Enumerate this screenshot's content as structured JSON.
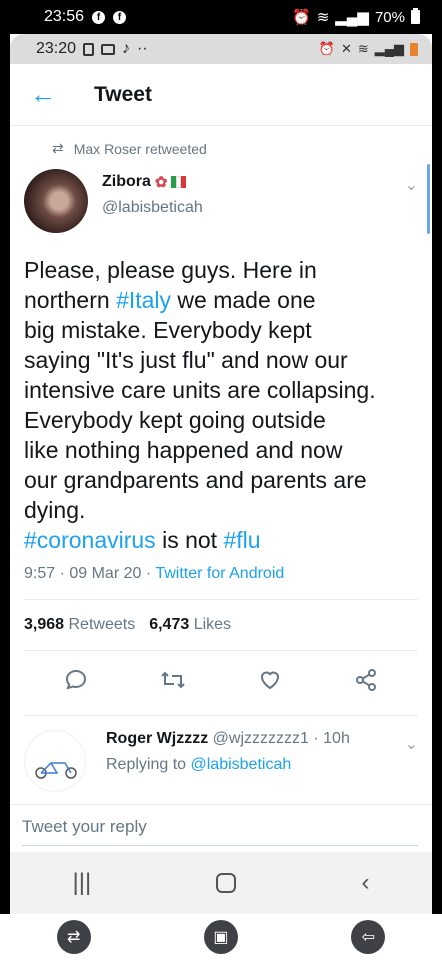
{
  "outer_status": {
    "time": "23:56",
    "battery": "70%"
  },
  "inner_status": {
    "time": "23:20"
  },
  "header": {
    "title": "Tweet"
  },
  "retweet": {
    "text": "Max Roser retweeted"
  },
  "author": {
    "name": "Zibora",
    "handle": "@labisbeticah"
  },
  "tweet": {
    "lines": [
      "Please, please guys. Here in",
      "northern ",
      "#Italy",
      " we made one",
      "big mistake. Everybody kept",
      "saying \"It's just flu\" and now our",
      "intensive care units are collapsing.",
      "Everybody kept going outside",
      "like nothing happened and now",
      "our grandparents and parents are",
      "dying."
    ],
    "tag_coronavirus": "#coronavirus",
    "mid": " is not ",
    "tag_flu": "#flu"
  },
  "meta": {
    "time": "9:57 · 09 Mar 20 · ",
    "source": "Twitter for Android"
  },
  "counts": {
    "retweets": "3,968",
    "retweets_label": "Retweets",
    "likes": "6,473",
    "likes_label": "Likes"
  },
  "reply": {
    "name": "Roger Wjzzzz",
    "handle": "@wjzzzzzzz1 · 10h",
    "replying_prefix": "Replying to ",
    "replying_handle": "@labisbeticah"
  },
  "reply_box": {
    "placeholder": "Tweet your reply"
  },
  "colors": {
    "accent": "#1da1f2",
    "muted": "#657786"
  }
}
